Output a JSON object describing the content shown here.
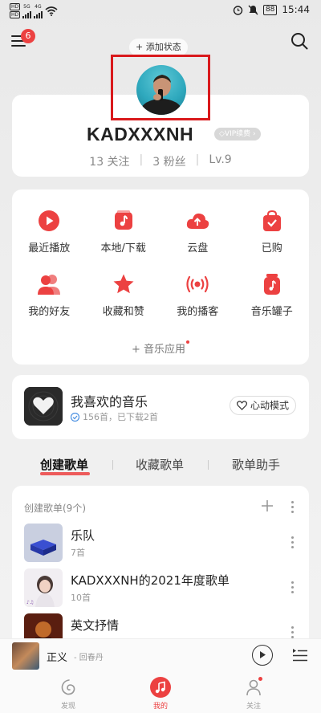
{
  "status_bar": {
    "hd1": "HD",
    "hd2": "HD",
    "net1": "5G",
    "net2": "4G",
    "battery": "88",
    "time": "15:44"
  },
  "top": {
    "menu_badge": "6",
    "add_status": "+ 添加状态"
  },
  "profile": {
    "nickname": "KADXXXNH",
    "vip": "◇VIP续费 ›",
    "following": "13 关注",
    "fans": "3 粉丝",
    "level": "Lv.9"
  },
  "apps": [
    {
      "label": "最近播放",
      "icon": "play-icon"
    },
    {
      "label": "本地/下载",
      "icon": "music-folder-icon"
    },
    {
      "label": "云盘",
      "icon": "cloud-upload-icon"
    },
    {
      "label": "已购",
      "icon": "shopping-bag-icon"
    },
    {
      "label": "我的好友",
      "icon": "friends-icon"
    },
    {
      "label": "收藏和赞",
      "icon": "star-icon"
    },
    {
      "label": "我的播客",
      "icon": "broadcast-icon"
    },
    {
      "label": "音乐罐子",
      "icon": "music-jar-icon"
    }
  ],
  "music_apps": "+ 音乐应用",
  "liked": {
    "title": "我喜欢的音乐",
    "subtitle": "156首，已下载2首",
    "heart_mode": "心动模式"
  },
  "tabs": [
    "创建歌单",
    "收藏歌单",
    "歌单助手"
  ],
  "playlists": {
    "header": "创建歌单(9个)",
    "items": [
      {
        "name": "乐队",
        "count": "7首"
      },
      {
        "name": "KADXXXNH的2021年度歌单",
        "count": "10首"
      },
      {
        "name": "英文抒情",
        "count": ""
      }
    ]
  },
  "player": {
    "title": "正义",
    "artist": "- 回春丹"
  },
  "nav": {
    "discover": "发现",
    "mine": "我的",
    "follow": "关注"
  },
  "colors": {
    "accent": "#ec4141"
  }
}
